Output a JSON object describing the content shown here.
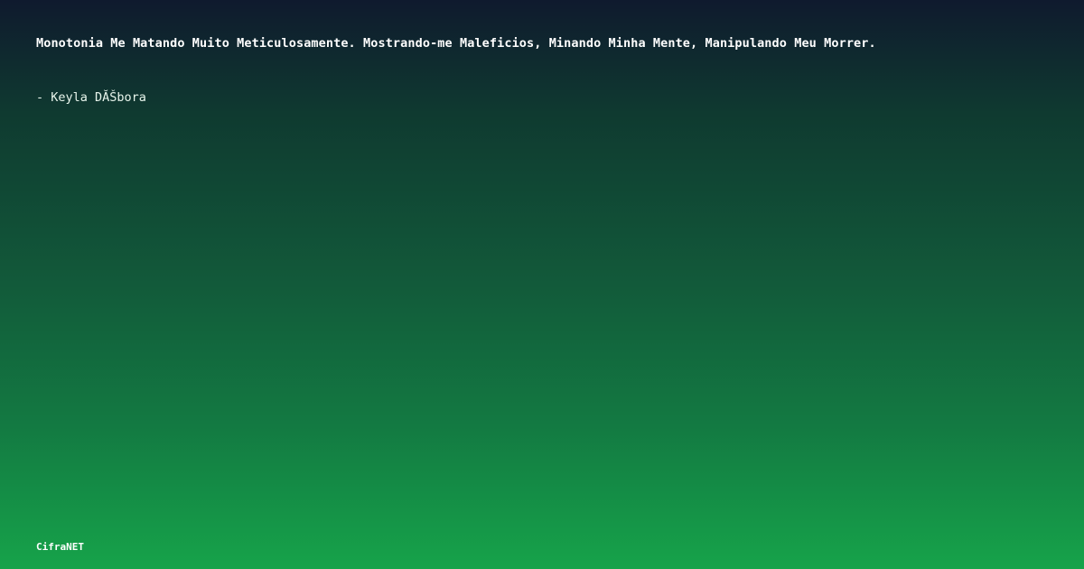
{
  "quote": {
    "text": "Monotonia Me Matando Muito Meticulosamente. Mostrando-me Maleficios, Minando Minha Mente, Manipulando Meu Morrer.",
    "author": "- Keyla DĂŠbora"
  },
  "brand": {
    "name": "CifraNET"
  },
  "colors": {
    "gradient_top": "#0f1a2e",
    "gradient_bottom": "#16a34a",
    "text": "#ffffff"
  }
}
